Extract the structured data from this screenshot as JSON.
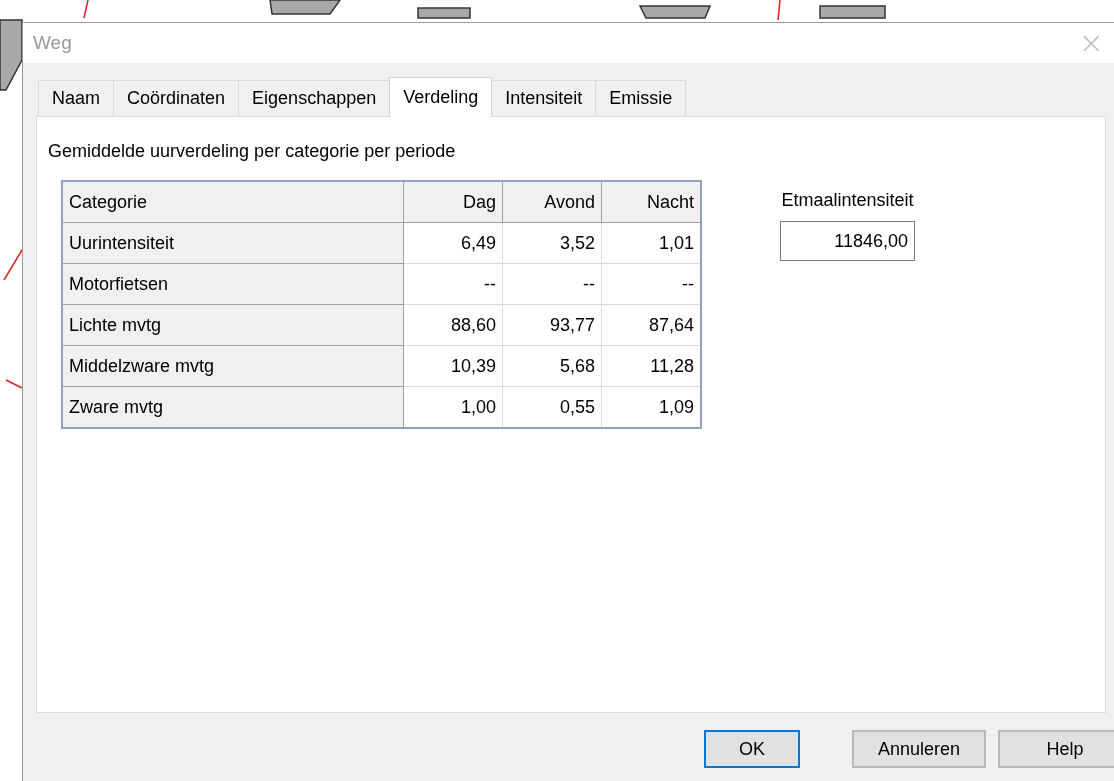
{
  "window": {
    "title": "Weg",
    "close": "×"
  },
  "tabs": [
    {
      "label": "Naam",
      "selected": false
    },
    {
      "label": "Coördinaten",
      "selected": false
    },
    {
      "label": "Eigenschappen",
      "selected": false
    },
    {
      "label": "Verdeling",
      "selected": true
    },
    {
      "label": "Intensiteit",
      "selected": false
    },
    {
      "label": "Emissie",
      "selected": false
    }
  ],
  "panel": {
    "heading": "Gemiddelde uurverdeling per categorie per periode",
    "table": {
      "columns": [
        "Categorie",
        "Dag",
        "Avond",
        "Nacht"
      ],
      "rows": [
        [
          "Uurintensiteit",
          "6,49",
          "3,52",
          "1,01"
        ],
        [
          "Motorfietsen",
          "--",
          "--",
          "--"
        ],
        [
          "Lichte mvtg",
          "88,60",
          "93,77",
          "87,64"
        ],
        [
          "Middelzware mvtg",
          "10,39",
          "5,68",
          "11,28"
        ],
        [
          "Zware mvtg",
          "1,00",
          "0,55",
          "1,09"
        ]
      ]
    },
    "etmaal": {
      "label": "Etmaalintensiteit",
      "value": "11846,00"
    }
  },
  "buttons": [
    {
      "label": "OK",
      "default": true
    },
    {
      "label": "Annuleren",
      "default": false
    },
    {
      "label": "Help",
      "default": false
    }
  ]
}
